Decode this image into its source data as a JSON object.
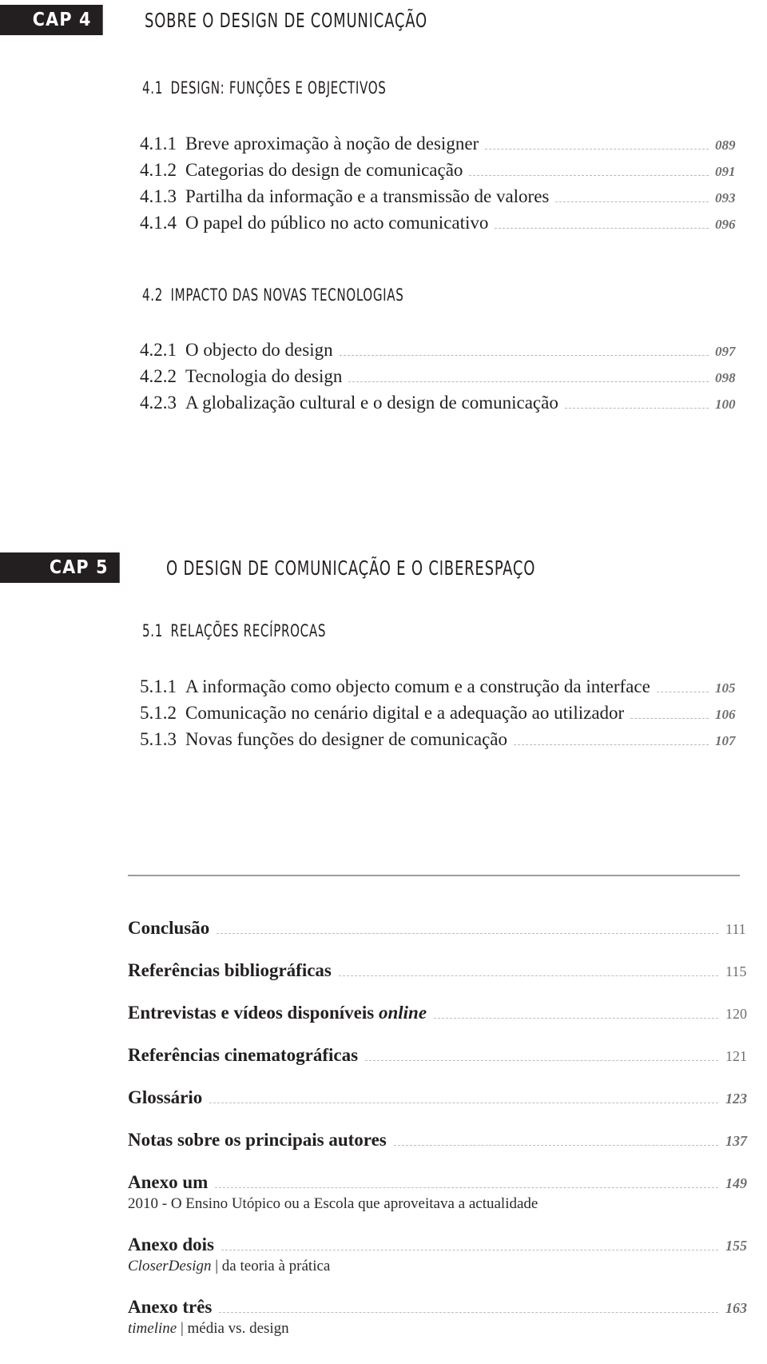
{
  "page": {
    "type": "table-of-contents",
    "accent_dark": "#231f20",
    "leader_color": "#b9b9b9",
    "page_number_color": "#6e6e6e"
  },
  "chapters": [
    {
      "tag": "CAP 4",
      "title": "SOBRE O DESIGN DE COMUNICAÇÃO",
      "sections": [
        {
          "number": "4.1",
          "title": "DESIGN: FUNÇÕES E OBJECTIVOS",
          "entries": [
            {
              "number": "4.1.1",
              "label": "Breve aproximação à noção de designer",
              "page": "089"
            },
            {
              "number": "4.1.2",
              "label": "Categorias do design de comunicação",
              "page": "091"
            },
            {
              "number": "4.1.3",
              "label": "Partilha da informação e a transmissão de valores",
              "page": "093"
            },
            {
              "number": "4.1.4",
              "label": "O papel do público no acto comunicativo",
              "page": "096"
            }
          ]
        },
        {
          "number": "4.2",
          "title": "IMPACTO DAS NOVAS TECNOLOGIAS",
          "entries": [
            {
              "number": "4.2.1",
              "label": "O objecto do design",
              "page": "097"
            },
            {
              "number": "4.2.2",
              "label": "Tecnologia do design",
              "page": "098"
            },
            {
              "number": "4.2.3",
              "label": "A globalização cultural e o design de comunicação",
              "page": "100"
            }
          ]
        }
      ]
    },
    {
      "tag": "CAP 5",
      "title": "O DESIGN DE COMUNICAÇÃO E O CIBERESPAÇO",
      "sections": [
        {
          "number": "5.1",
          "title": "RELAÇÕES RECÍPROCAS",
          "entries": [
            {
              "number": "5.1.1",
              "label": "A informação como objecto comum e a construção da interface",
              "page": "105"
            },
            {
              "number": "5.1.2",
              "label": "Comunicação no cenário digital e a adequação ao utilizador",
              "page": "106"
            },
            {
              "number": "5.1.3",
              "label": "Novas funções do designer de comunicação",
              "page": "107"
            }
          ]
        }
      ]
    }
  ],
  "back_matter": [
    {
      "label": "Conclusão",
      "page": "111"
    },
    {
      "label": "Referências bibliográficas",
      "page": "115"
    },
    {
      "label": "Entrevistas e vídeos disponíveis ",
      "label_em": "online",
      "page": "120"
    },
    {
      "label": "Referências cinematográficas",
      "page": "121"
    },
    {
      "label": "Glossário",
      "page": "123"
    },
    {
      "label": "Notas sobre os principais autores",
      "page": "137"
    },
    {
      "label": "Anexo um",
      "page": "149",
      "subtitle": "2010 - O Ensino Utópico ou a Escola que aproveitava a actualidade"
    },
    {
      "label": "Anexo dois",
      "page": "155",
      "subtitle_em": "CloserDesign",
      "subtitle_rest": " | da teoria à prática"
    },
    {
      "label": "Anexo três",
      "page": "163",
      "subtitle_em": "timeline",
      "subtitle_rest": " | média vs. design"
    }
  ]
}
